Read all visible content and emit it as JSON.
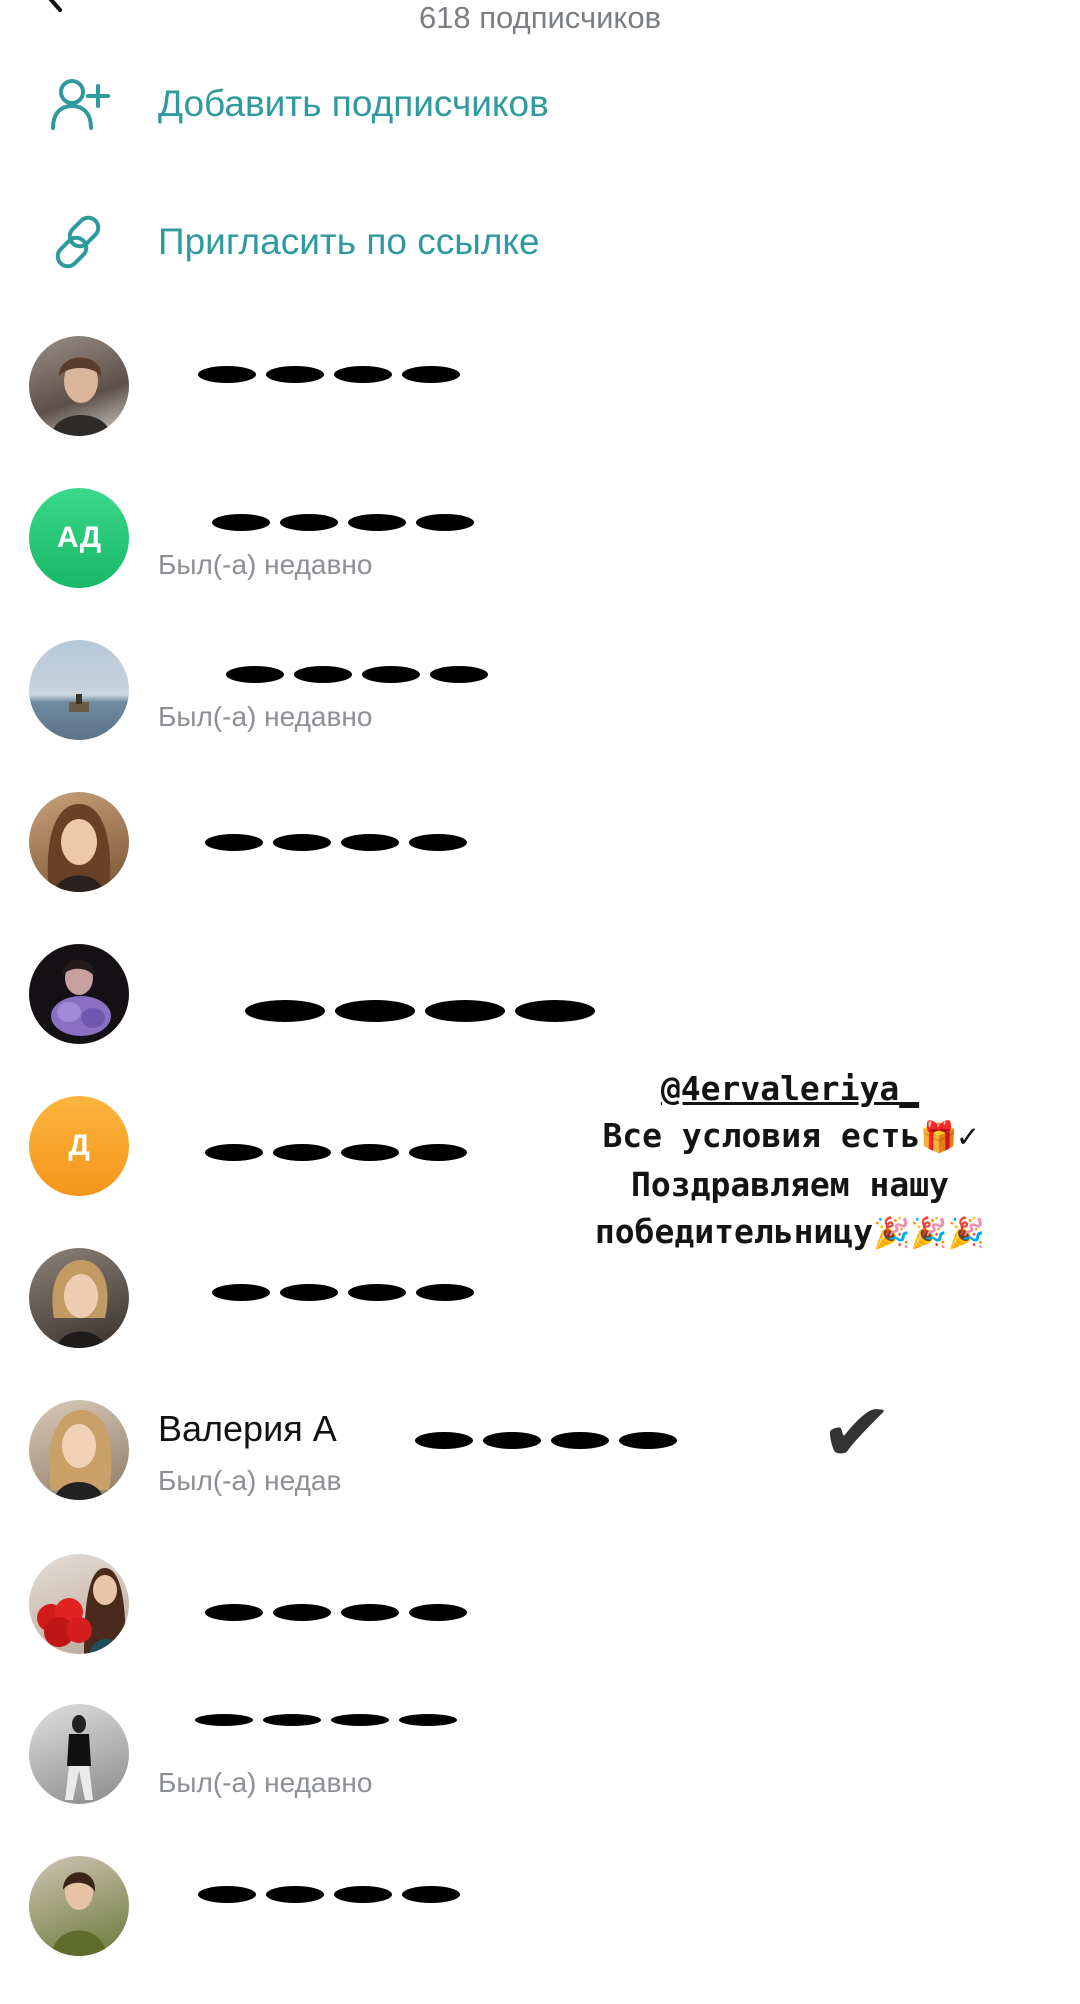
{
  "header": {
    "subtitle": "618 подписчиков"
  },
  "actions": [
    {
      "label": "Добавить подписчиков",
      "icon": "add-user-icon"
    },
    {
      "label": "Пригласить по ссылке",
      "icon": "link-icon"
    }
  ],
  "members": [
    {
      "initials": "",
      "status": ""
    },
    {
      "initials": "АД",
      "status": "Был(-а) недавно"
    },
    {
      "initials": "",
      "status": "Был(-а) недавно"
    },
    {
      "initials": "",
      "status": ""
    },
    {
      "initials": "",
      "status": ""
    },
    {
      "initials": "Д",
      "status": ""
    },
    {
      "initials": "",
      "status": ""
    },
    {
      "initials": "",
      "name": "Валерия А",
      "status": "Был(-а) недав"
    },
    {
      "initials": "",
      "status": ""
    },
    {
      "initials": "",
      "status": "Был(-а) недавно"
    },
    {
      "initials": "",
      "status": ""
    }
  ],
  "overlay": {
    "handle": "@4ervaleriya_",
    "line1": "Все условия есть",
    "line2": "Поздравляем нашу",
    "line3": "победительницу",
    "gift_emoji": "🎁",
    "check_mark": "✓",
    "party_emoji": "🎉🎉🎉",
    "big_check": "✔"
  },
  "colors": {
    "accent": "#2f9a9e",
    "avatar_green": "#1fc774",
    "avatar_orange": "#f9a326"
  }
}
